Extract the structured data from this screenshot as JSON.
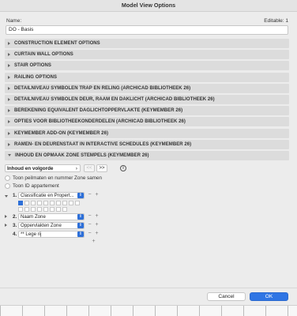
{
  "window": {
    "title": "Model View Options"
  },
  "name_field": {
    "label": "Name:",
    "editable_label": "Editable: 1",
    "value": "DO - Basis"
  },
  "sections": [
    {
      "label": "CONSTRUCTION ELEMENT OPTIONS",
      "expanded": false
    },
    {
      "label": "CURTAIN WALL OPTIONS",
      "expanded": false
    },
    {
      "label": "STAIR OPTIONS",
      "expanded": false
    },
    {
      "label": "RAILING OPTIONS",
      "expanded": false
    },
    {
      "label": "DETAILNIVEAU SYMBOLEN TRAP EN RELING (ARCHICAD BIBLIOTHEEK 26)",
      "expanded": false
    },
    {
      "label": "DETAILNIVEAU SYMBOLEN DEUR, RAAM EN DAKLICHT (ARCHICAD BIBLIOTHEEK 26)",
      "expanded": false
    },
    {
      "label": "BEREKENING EQUIVALENT DAGLICHTOPPERVLAKTE (KEYMEMBER 26)",
      "expanded": false
    },
    {
      "label": "OPTIES VOOR BIBLIOTHEEKONDERDELEN (ARCHICAD BIBLIOTHEEK 26)",
      "expanded": false
    },
    {
      "label": "KEYMEMBER ADD-ON (KEYMEMBER 26)",
      "expanded": false
    },
    {
      "label": "RAMEN- EN DEURENSTAAT IN INTERACTIVE SCHEDULES (KEYMEMBER 26)",
      "expanded": false
    },
    {
      "label": "INHOUD EN OPMAAK ZONE STEMPELS (KEYMEMBER 26)",
      "expanded": true
    }
  ],
  "zone_panel": {
    "page_select": "Inhoud en volgorde",
    "prev_label": "<<",
    "next_label": ">>",
    "info_icon": "info-circle-icon",
    "radio_options": [
      "Toon peilmaten en nummer Zone samen",
      "Toon ID appartement"
    ],
    "rows": [
      {
        "number": "1.",
        "field": "Classificatie en Propert...",
        "expanded": true
      },
      {
        "number": "2.",
        "field": "Naam Zone",
        "expanded": false
      },
      {
        "number": "3.",
        "field": "Oppervlakten Zone",
        "expanded": false
      },
      {
        "number": "4.",
        "field": "** Lege rij",
        "expanded": false
      }
    ],
    "minus": "−",
    "plus": "+"
  },
  "buttons": {
    "cancel": "Cancel",
    "ok": "OK"
  },
  "colors": {
    "accent": "#2f75e4",
    "section_bg": "#dcdcdc"
  }
}
